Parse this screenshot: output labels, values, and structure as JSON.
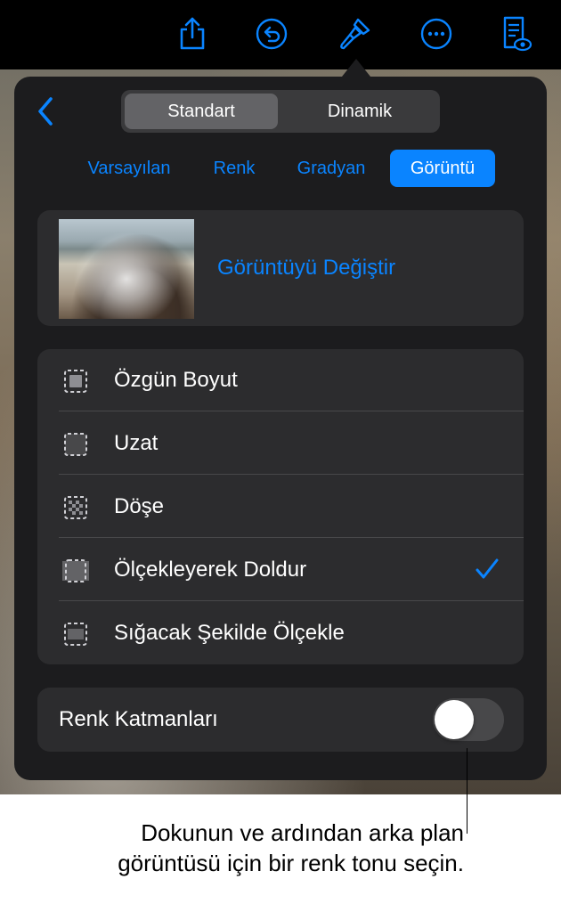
{
  "toolbar": {
    "icons": [
      "share-icon",
      "undo-icon",
      "format-brush-icon",
      "more-icon",
      "document-view-icon"
    ]
  },
  "popover": {
    "segments": [
      "Standart",
      "Dinamik"
    ],
    "selected_segment": "Standart",
    "fill_tabs": [
      "Varsayılan",
      "Renk",
      "Gradyan",
      "Görüntü"
    ],
    "selected_fill_tab": "Görüntü",
    "change_image_label": "Görüntüyü Değiştir",
    "scale_options": [
      {
        "label": "Özgün Boyut",
        "icon": "original-size-icon",
        "selected": false
      },
      {
        "label": "Uzat",
        "icon": "stretch-icon",
        "selected": false
      },
      {
        "label": "Döşe",
        "icon": "tile-icon",
        "selected": false
      },
      {
        "label": "Ölçekleyerek Doldur",
        "icon": "scale-to-fill-icon",
        "selected": true
      },
      {
        "label": "Sığacak Şekilde Ölçekle",
        "icon": "scale-to-fit-icon",
        "selected": false
      }
    ],
    "color_overlay_label": "Renk Katmanları",
    "color_overlay_on": false
  },
  "callout": {
    "text": "Dokunun ve ardından arka plan görüntüsü için bir renk tonu seçin."
  },
  "colors": {
    "accent": "#0a84ff",
    "popover_bg": "#1c1c1e",
    "card_bg": "#2c2c2e"
  }
}
